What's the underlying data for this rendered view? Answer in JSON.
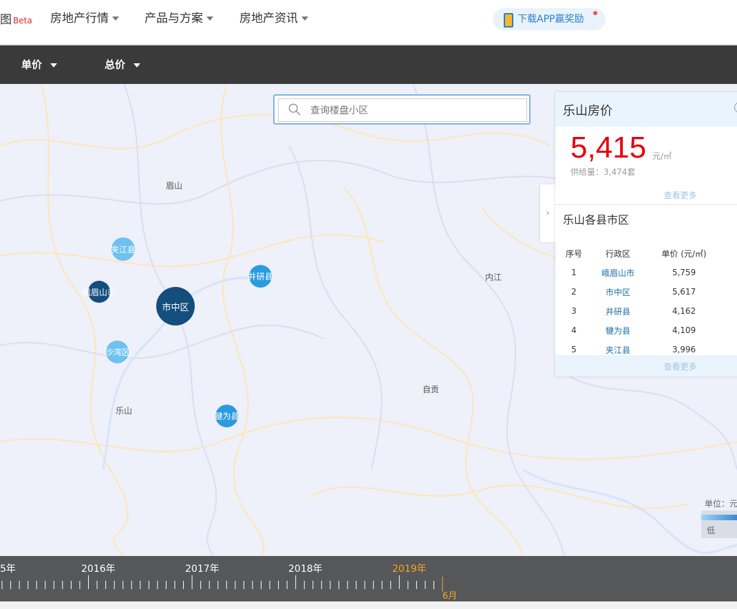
{
  "topnav": {
    "logo": "图",
    "beta": "Beta",
    "items": [
      {
        "label": "房地产行情"
      },
      {
        "label": "产品与方案"
      },
      {
        "label": "房地产资讯"
      }
    ],
    "app_button": "下载APP赢奖励"
  },
  "filters": {
    "unit_price": "单价",
    "total_price": "总价"
  },
  "search": {
    "placeholder": "查询楼盘小区"
  },
  "map": {
    "labels": {
      "meishan": "眉山",
      "neijiang": "内江",
      "zigong": "自贡",
      "leshan": "乐山"
    },
    "bubbles": [
      {
        "name": "夹江县",
        "color": "#6ec1f0"
      },
      {
        "name": "峨眉山市",
        "color": "#134e7c"
      },
      {
        "name": "市中区",
        "color": "#134e7c"
      },
      {
        "name": "井研县",
        "color": "#2b9be0"
      },
      {
        "name": "沙湾区",
        "color": "#6ec1f0"
      },
      {
        "name": "犍为县",
        "color": "#2b9be0"
      }
    ],
    "legend_unit": "单位：元",
    "legend_low": "低"
  },
  "panel": {
    "title": "乐山房价",
    "price": "5,415",
    "unit": "元/㎡",
    "supply": "供给量：3,474套",
    "more": "查看更多",
    "sub_title": "乐山各县市区",
    "columns": [
      "序号",
      "行政区",
      "单价 (元/㎡)"
    ],
    "rows": [
      {
        "rank": "1",
        "district": "峨眉山市",
        "price": "5,759"
      },
      {
        "rank": "2",
        "district": "市中区",
        "price": "5,617"
      },
      {
        "rank": "3",
        "district": "井研县",
        "price": "4,162"
      },
      {
        "rank": "4",
        "district": "犍为县",
        "price": "4,109"
      },
      {
        "rank": "5",
        "district": "夹江县",
        "price": "3,996"
      }
    ],
    "more2": "查看更多"
  },
  "timeline": {
    "years": [
      "5年",
      "2016年",
      "2017年",
      "2018年",
      "2019年"
    ],
    "active_year": "2019年",
    "month": "6月"
  },
  "colors": {
    "accent": "#2a7fc9",
    "price_red": "#e8000e",
    "timeline_active": "#f5a623"
  }
}
